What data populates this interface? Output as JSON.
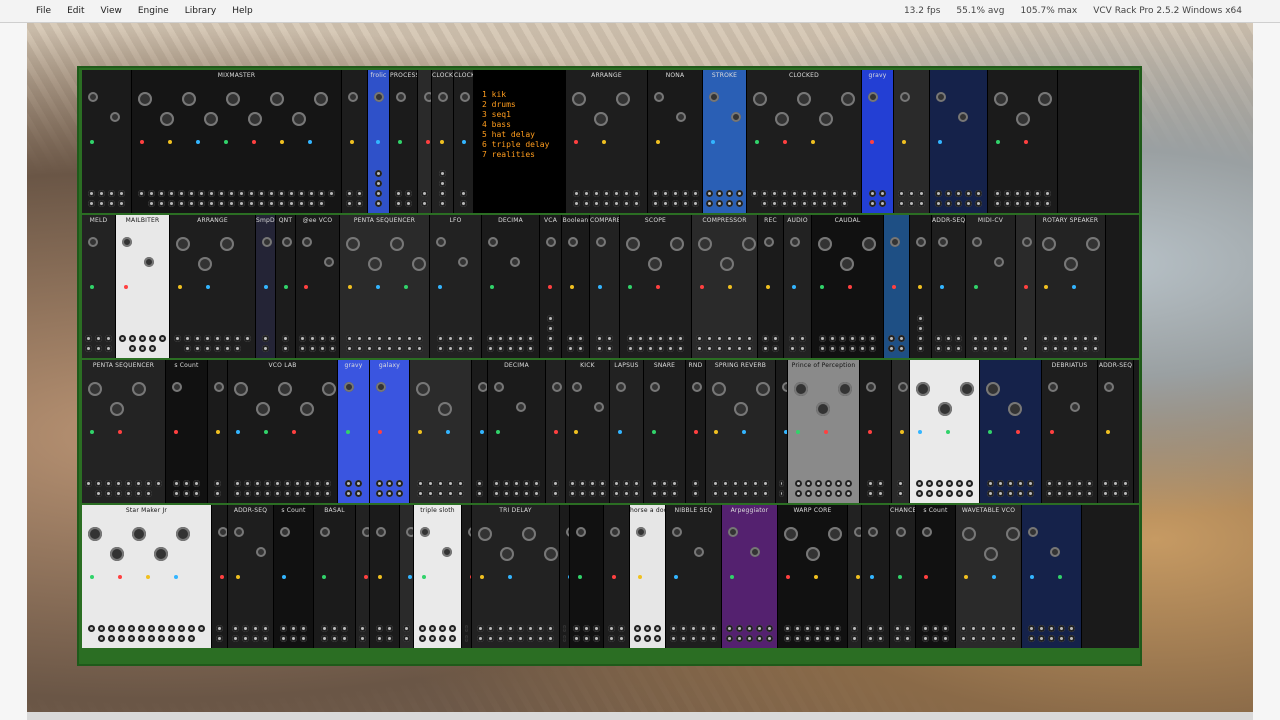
{
  "menubar": {
    "items": [
      "File",
      "Edit",
      "View",
      "Engine",
      "Library",
      "Help"
    ],
    "status": {
      "fps": "13.2 fps",
      "avg": "55.1% avg",
      "max": "105.7% max",
      "app": "VCV Rack Pro 2.5.2 Windows x64"
    }
  },
  "colors": {
    "rack_frame": "#2b6e23",
    "panel_dark": "#1a1a1a",
    "text_amber": "#ff9d1e"
  },
  "rows": [
    [
      {
        "name": "",
        "w": 50,
        "bg": "#1b1b1b"
      },
      {
        "name": "MIXMASTER",
        "w": 210,
        "bg": "#151515"
      },
      {
        "name": "",
        "w": 26,
        "bg": "#1d1d1d"
      },
      {
        "name": "frolic",
        "w": 22,
        "bg": "#2f51c9"
      },
      {
        "name": "PROCESS",
        "w": 28,
        "bg": "#1b1b1b"
      },
      {
        "name": "",
        "w": 14,
        "bg": "#2a2a2a"
      },
      {
        "name": "CLOCK",
        "w": 22,
        "bg": "#222"
      },
      {
        "name": "CLOCK DIV",
        "w": 20,
        "bg": "#1e1e1e"
      },
      {
        "name": "__tracklist",
        "w": 92,
        "bg": "#000"
      },
      {
        "name": "ARRANGE",
        "w": 82,
        "bg": "#1e1e1e"
      },
      {
        "name": "NONA",
        "w": 55,
        "bg": "#1a1a1a"
      },
      {
        "name": "STROKE",
        "w": 44,
        "bg": "#2a5fb5"
      },
      {
        "name": "CLOCKED",
        "w": 115,
        "bg": "#1e1e1e"
      },
      {
        "name": "gravy",
        "w": 32,
        "bg": "#233fd4"
      },
      {
        "name": "",
        "w": 36,
        "bg": "#2a2a2a"
      },
      {
        "name": "",
        "w": 58,
        "bg": "#15224a"
      },
      {
        "name": "",
        "w": 70,
        "bg": "#1b1b1b"
      }
    ],
    [
      {
        "name": "MELD",
        "w": 34,
        "bg": "#232323"
      },
      {
        "name": "MAILBITER",
        "w": 54,
        "bg": "#e8e8e8"
      },
      {
        "name": "ARRANGE",
        "w": 86,
        "bg": "#1e1e1e"
      },
      {
        "name": "SmpDly",
        "w": 20,
        "bg": "#242436"
      },
      {
        "name": "QNT",
        "w": 20,
        "bg": "#1c1c1c"
      },
      {
        "name": "@ee VCO",
        "w": 44,
        "bg": "#1b1b1b"
      },
      {
        "name": "PENTA SEQUENCER",
        "w": 90,
        "bg": "#2a2a2a"
      },
      {
        "name": "LFO",
        "w": 52,
        "bg": "#222"
      },
      {
        "name": "DECIMA",
        "w": 58,
        "bg": "#1b1b1b"
      },
      {
        "name": "VCA",
        "w": 22,
        "bg": "#1c1c1c"
      },
      {
        "name": "Boolean",
        "w": 28,
        "bg": "#1a1a1a"
      },
      {
        "name": "COMPARE",
        "w": 30,
        "bg": "#222"
      },
      {
        "name": "SCOPE",
        "w": 72,
        "bg": "#1e1e1e"
      },
      {
        "name": "COMPRESSOR",
        "w": 66,
        "bg": "#2a2a2a"
      },
      {
        "name": "REC",
        "w": 26,
        "bg": "#1b1b1b"
      },
      {
        "name": "AUDIO",
        "w": 28,
        "bg": "#222"
      },
      {
        "name": "CAUDAL",
        "w": 72,
        "bg": "#111"
      },
      {
        "name": "",
        "w": 26,
        "bg": "#1e4f84"
      },
      {
        "name": "",
        "w": 22,
        "bg": "#1b1b1b"
      },
      {
        "name": "ADDR-SEQ",
        "w": 34,
        "bg": "#1e1e1e"
      },
      {
        "name": "MIDI-CV",
        "w": 50,
        "bg": "#222"
      },
      {
        "name": "",
        "w": 20,
        "bg": "#2a2a2a"
      },
      {
        "name": "ROTARY SPEAKER",
        "w": 70,
        "bg": "#232323"
      }
    ],
    [
      {
        "name": "PENTA SEQUENCER",
        "w": 84,
        "bg": "#232323"
      },
      {
        "name": "s Count",
        "w": 42,
        "bg": "#111"
      },
      {
        "name": "",
        "w": 20,
        "bg": "#1b1b1b"
      },
      {
        "name": "VCO LAB",
        "w": 110,
        "bg": "#1a1a1a"
      },
      {
        "name": "gravy",
        "w": 32,
        "bg": "#3a55e0"
      },
      {
        "name": "galaxy",
        "w": 40,
        "bg": "#3a55e0"
      },
      {
        "name": "",
        "w": 62,
        "bg": "#2b2b2b"
      },
      {
        "name": "",
        "w": 16,
        "bg": "#1b1b1b"
      },
      {
        "name": "DECIMA",
        "w": 58,
        "bg": "#1b1b1b"
      },
      {
        "name": "",
        "w": 20,
        "bg": "#222"
      },
      {
        "name": "KICK",
        "w": 44,
        "bg": "#1e1e1e"
      },
      {
        "name": "LAPSUS",
        "w": 34,
        "bg": "#222"
      },
      {
        "name": "SNARE",
        "w": 42,
        "bg": "#1e1e1e"
      },
      {
        "name": "RND",
        "w": 20,
        "bg": "#1a1a1a"
      },
      {
        "name": "SPRING REVERB",
        "w": 70,
        "bg": "#252525"
      },
      {
        "name": "",
        "w": 12,
        "bg": "#1b1b1b"
      },
      {
        "name": "Prince of Perception",
        "w": 72,
        "bg": "#8a8a8a"
      },
      {
        "name": "",
        "w": 32,
        "bg": "#1b1b1b"
      },
      {
        "name": "",
        "w": 18,
        "bg": "#2a2a2a"
      },
      {
        "name": "",
        "w": 70,
        "bg": "#eaeaea"
      },
      {
        "name": "",
        "w": 62,
        "bg": "#15224a"
      },
      {
        "name": "DEBRIATUS",
        "w": 56,
        "bg": "#1e1e1e"
      },
      {
        "name": "ADDR-SEQ",
        "w": 36,
        "bg": "#1e1e1e"
      }
    ],
    [
      {
        "name": "Star Maker Jr",
        "w": 130,
        "bg": "#e9e9e9"
      },
      {
        "name": "",
        "w": 16,
        "bg": "#1b1b1b"
      },
      {
        "name": "ADDR-SEQ",
        "w": 46,
        "bg": "#1e1e1e"
      },
      {
        "name": "s Count",
        "w": 40,
        "bg": "#111"
      },
      {
        "name": "BASAL",
        "w": 42,
        "bg": "#1b1b1b"
      },
      {
        "name": "",
        "w": 14,
        "bg": "#222"
      },
      {
        "name": "",
        "w": 30,
        "bg": "#1b1b1b"
      },
      {
        "name": "",
        "w": 14,
        "bg": "#2a2a2a"
      },
      {
        "name": "triple sloth",
        "w": 48,
        "bg": "#eaeaea"
      },
      {
        "name": "",
        "w": 10,
        "bg": "#1b1b1b"
      },
      {
        "name": "TRI DELAY",
        "w": 88,
        "bg": "#222"
      },
      {
        "name": "",
        "w": 10,
        "bg": "#1b1b1b"
      },
      {
        "name": "",
        "w": 34,
        "bg": "#111"
      },
      {
        "name": "",
        "w": 26,
        "bg": "#1e1e1e"
      },
      {
        "name": "horse a doodle doo",
        "w": 36,
        "bg": "#e6e6e6"
      },
      {
        "name": "NIBBLE SEQ",
        "w": 56,
        "bg": "#1e1e1e"
      },
      {
        "name": "Arpeggiator",
        "w": 56,
        "bg": "#54216f"
      },
      {
        "name": "WARP CORE",
        "w": 70,
        "bg": "#111"
      },
      {
        "name": "",
        "w": 14,
        "bg": "#222"
      },
      {
        "name": "",
        "w": 28,
        "bg": "#1b1b1b"
      },
      {
        "name": "CHANCE",
        "w": 26,
        "bg": "#1e1e1e"
      },
      {
        "name": "s Count",
        "w": 40,
        "bg": "#111"
      },
      {
        "name": "WAVETABLE VCO",
        "w": 66,
        "bg": "#2a2a2a"
      },
      {
        "name": "",
        "w": 60,
        "bg": "#15224a"
      }
    ]
  ],
  "tracklist": {
    "lines": [
      "1 kik",
      "2 drums",
      "3 seq1",
      "4 bass",
      "5 hat delay",
      "6 triple delay",
      "7 realities"
    ]
  }
}
